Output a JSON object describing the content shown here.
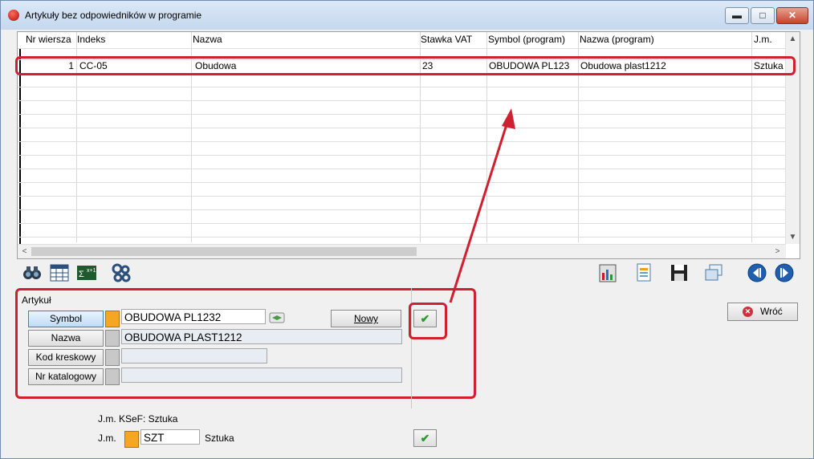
{
  "window": {
    "title": "Artykuły bez odpowiedników w programie",
    "controls": {
      "minimize": "▬",
      "maximize": "□",
      "close": "✕"
    }
  },
  "grid": {
    "columns": [
      "Nr wiersza",
      "Indeks",
      "Nazwa",
      "Stawka VAT",
      "Symbol (program)",
      "Nazwa (program)",
      "J.m."
    ],
    "rows": [
      [
        "1",
        "CC-05",
        "Obudowa",
        "23",
        "OBUDOWA PL123",
        "Obudowa plast1212",
        "Sztuka"
      ]
    ],
    "scroll_left": "<",
    "scroll_right": ">",
    "scroll_up": "^",
    "scroll_down": "v"
  },
  "toolbar": {
    "left_icons": [
      "binoculars-icon",
      "table-grid-icon",
      "sum-formula-icon",
      "gears-icon"
    ],
    "right_icons": [
      "chart-icon",
      "document-icon",
      "save-icon",
      "windows-icon",
      "previous-icon",
      "next-icon"
    ]
  },
  "form": {
    "group_title": "Artykuł",
    "symbol_label": "Symbol",
    "symbol_value": "OBUDOWA PL1232",
    "nazwa_label": "Nazwa",
    "nazwa_value": "OBUDOWA PLAST1212",
    "kod_label": "Kod kreskowy",
    "kod_value": "",
    "nr_label": "Nr katalogowy",
    "nr_value": "",
    "nowy_label": "Nowy",
    "ok_symbol": "✔"
  },
  "return_button": {
    "label": "Wróć"
  },
  "bottom": {
    "ksef_label": "J.m. KSeF: Sztuka",
    "jm_label": "J.m.",
    "jm_value": "SZT",
    "jm_desc": "Sztuka"
  },
  "colors": {
    "highlight": "#d0202f",
    "accent": "#3c7fb1",
    "ok_green": "#2c9b2c"
  }
}
